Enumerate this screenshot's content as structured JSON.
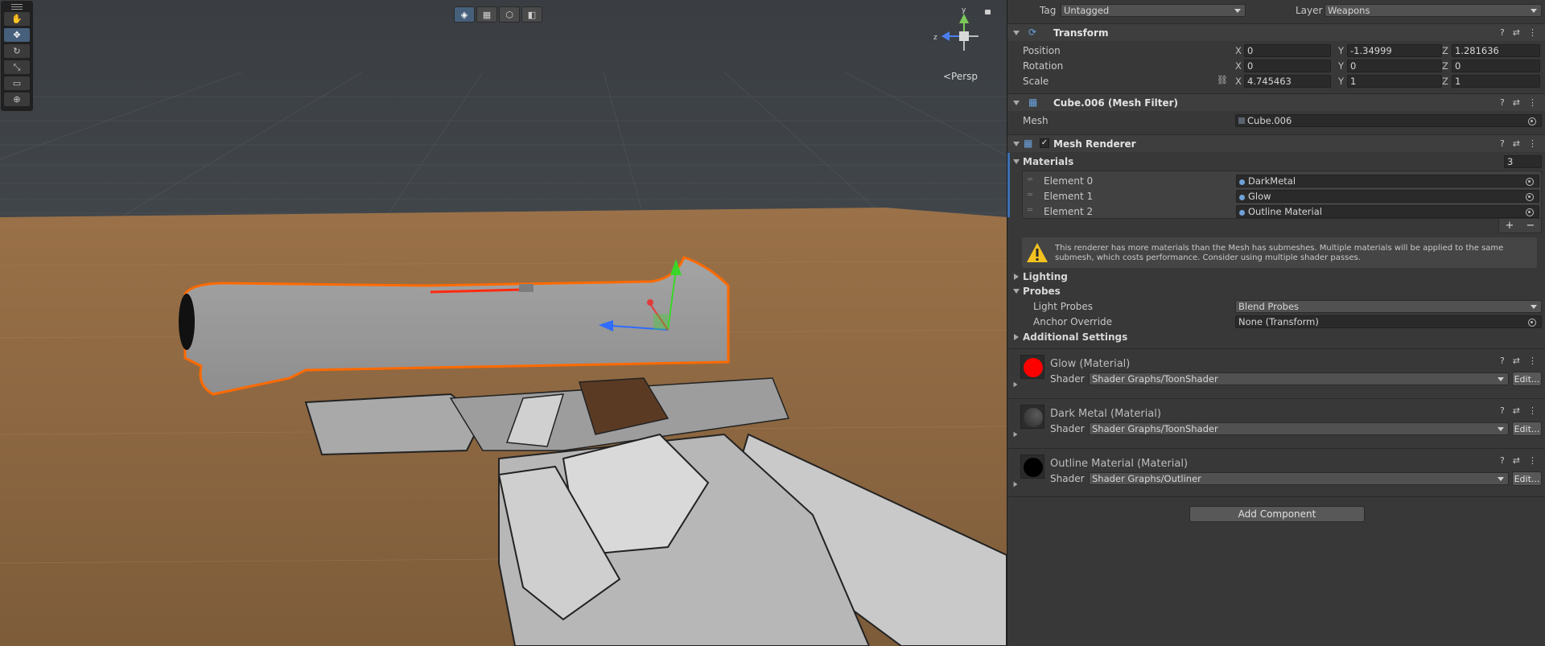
{
  "scene": {
    "persp_label": "<Persp",
    "gizmo": {
      "y": "y",
      "z": "z"
    },
    "tools": [
      {
        "icon": "hand-icon",
        "glyph": "✋"
      },
      {
        "icon": "move-icon",
        "glyph": "✥"
      },
      {
        "icon": "rotate-icon",
        "glyph": "↻"
      },
      {
        "icon": "scale-icon",
        "glyph": "⤡"
      },
      {
        "icon": "rect-icon",
        "glyph": "▭"
      },
      {
        "icon": "transform-icon",
        "glyph": "⊕"
      }
    ],
    "view_buttons": [
      {
        "icon": "shaded-icon",
        "glyph": "◈"
      },
      {
        "icon": "wireframe-icon",
        "glyph": "▦"
      },
      {
        "icon": "unlit-icon",
        "glyph": "⬡"
      },
      {
        "icon": "lit-icon",
        "glyph": "◧"
      }
    ]
  },
  "inspector": {
    "tag_label": "Tag",
    "tag_value": "Untagged",
    "layer_label": "Layer",
    "layer_value": "Weapons",
    "transform": {
      "title": "Transform",
      "position": {
        "label": "Position",
        "x": "0",
        "y": "-1.34999",
        "z": "1.281636"
      },
      "rotation": {
        "label": "Rotation",
        "x": "0",
        "y": "0",
        "z": "0"
      },
      "scale": {
        "label": "Scale",
        "x": "4.745463",
        "y": "1",
        "z": "1"
      }
    },
    "mesh_filter": {
      "title": "Cube.006 (Mesh Filter)",
      "mesh_label": "Mesh",
      "mesh_value": "Cube.006"
    },
    "mesh_renderer": {
      "title": "Mesh Renderer",
      "materials_label": "Materials",
      "materials_count": "3",
      "elements": [
        {
          "label": "Element 0",
          "value": "DarkMetal"
        },
        {
          "label": "Element 1",
          "value": "Glow"
        },
        {
          "label": "Element 2",
          "value": "Outline Material"
        }
      ],
      "add": "+",
      "remove": "−",
      "warning": "This renderer has more materials than the Mesh has submeshes. Multiple materials will be applied to the same submesh, which costs performance. Consider using multiple shader passes.",
      "lighting": "Lighting",
      "probes": "Probes",
      "light_probes_label": "Light Probes",
      "light_probes_value": "Blend Probes",
      "anchor_label": "Anchor Override",
      "anchor_value": "None (Transform)",
      "additional": "Additional Settings"
    },
    "materials": [
      {
        "name": "Glow (Material)",
        "shader_label": "Shader",
        "shader": "Shader Graphs/ToonShader",
        "edit": "Edit...",
        "color": "#ff0000"
      },
      {
        "name": "Dark Metal (Material)",
        "shader_label": "Shader",
        "shader": "Shader Graphs/ToonShader",
        "edit": "Edit...",
        "color": "#3a3a3a"
      },
      {
        "name": "Outline Material (Material)",
        "shader_label": "Shader",
        "shader": "Shader Graphs/Outliner",
        "edit": "Edit...",
        "color": "#000000"
      }
    ],
    "add_component": "Add Component"
  },
  "colors": {
    "selection_outline": "#ff6a00",
    "glow": "#ff2a10",
    "floor": "#8c6640",
    "sky": "#3a3e42"
  }
}
